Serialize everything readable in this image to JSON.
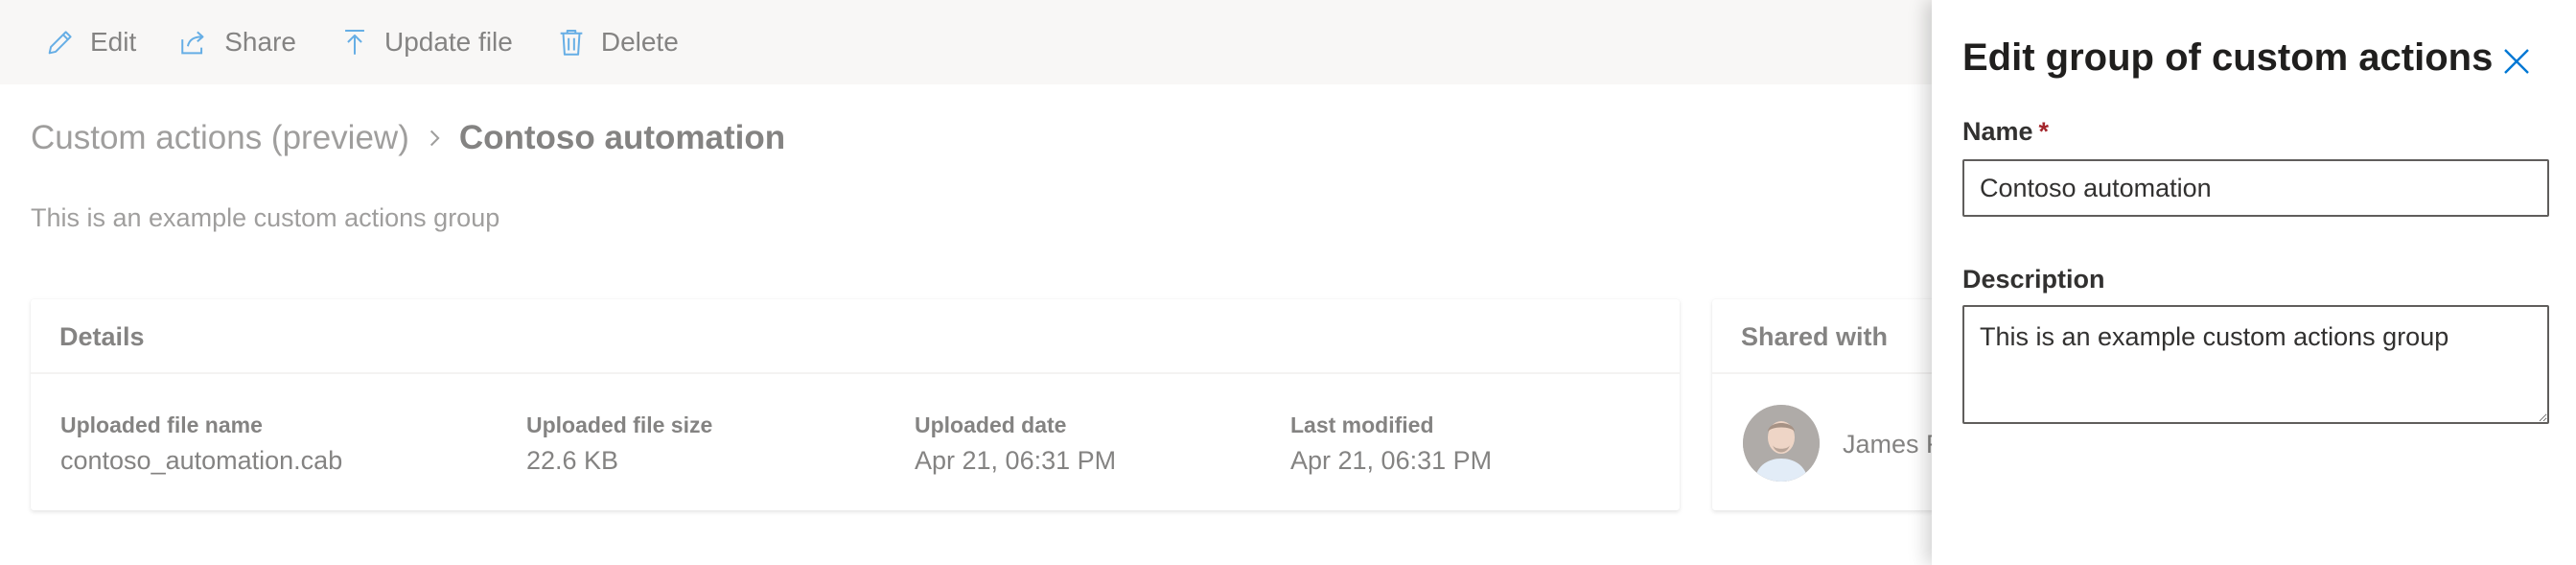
{
  "commandbar": {
    "items": [
      {
        "label": "Edit",
        "icon": "pencil-icon"
      },
      {
        "label": "Share",
        "icon": "share-icon"
      },
      {
        "label": "Update file",
        "icon": "upload-icon"
      },
      {
        "label": "Delete",
        "icon": "trash-icon"
      }
    ]
  },
  "breadcrumb": {
    "parent": "Custom actions (preview)",
    "current": "Contoso automation"
  },
  "page": {
    "description": "This is an example custom actions group"
  },
  "details": {
    "title": "Details",
    "fields": [
      {
        "label": "Uploaded file name",
        "value": "contoso_automation.cab"
      },
      {
        "label": "Uploaded file size",
        "value": "22.6 KB"
      },
      {
        "label": "Uploaded date",
        "value": "Apr 21, 06:31 PM"
      },
      {
        "label": "Last modified",
        "value": "Apr 21, 06:31 PM"
      }
    ]
  },
  "shared": {
    "title": "Shared with",
    "user_name": "James R"
  },
  "panel": {
    "title": "Edit group of custom actions",
    "name_label": "Name",
    "required_marker": "*",
    "name_value": "Contoso automation",
    "description_label": "Description",
    "description_value": "This is an example custom actions group"
  },
  "colors": {
    "accent": "#0078d4",
    "required": "#a4262c",
    "commandbar_bg": "#f3f2f1"
  }
}
